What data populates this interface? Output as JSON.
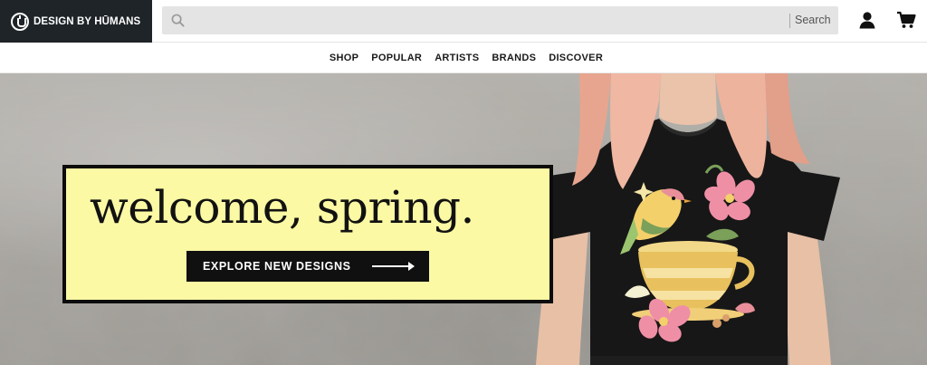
{
  "brand": {
    "name": "DESIGN BY HŪMANS",
    "logo_icon": "dbh-logo-icon"
  },
  "search": {
    "placeholder": "",
    "button_label": "Search",
    "icon": "search-icon"
  },
  "header_icons": {
    "account": "user-icon",
    "cart": "cart-icon"
  },
  "nav": {
    "items": [
      "SHOP",
      "POPULAR",
      "ARTISTS",
      "BRANDS",
      "DISCOVER"
    ]
  },
  "hero": {
    "headline": "welcome, spring.",
    "cta_label": "EXPLORE NEW DESIGNS",
    "cta_icon": "arrow-right-icon",
    "box_color": "#fbf9a4"
  },
  "colors": {
    "header_dark": "#1f2428",
    "accent_yellow": "#fbf9a4",
    "cta_bg": "#101010"
  }
}
